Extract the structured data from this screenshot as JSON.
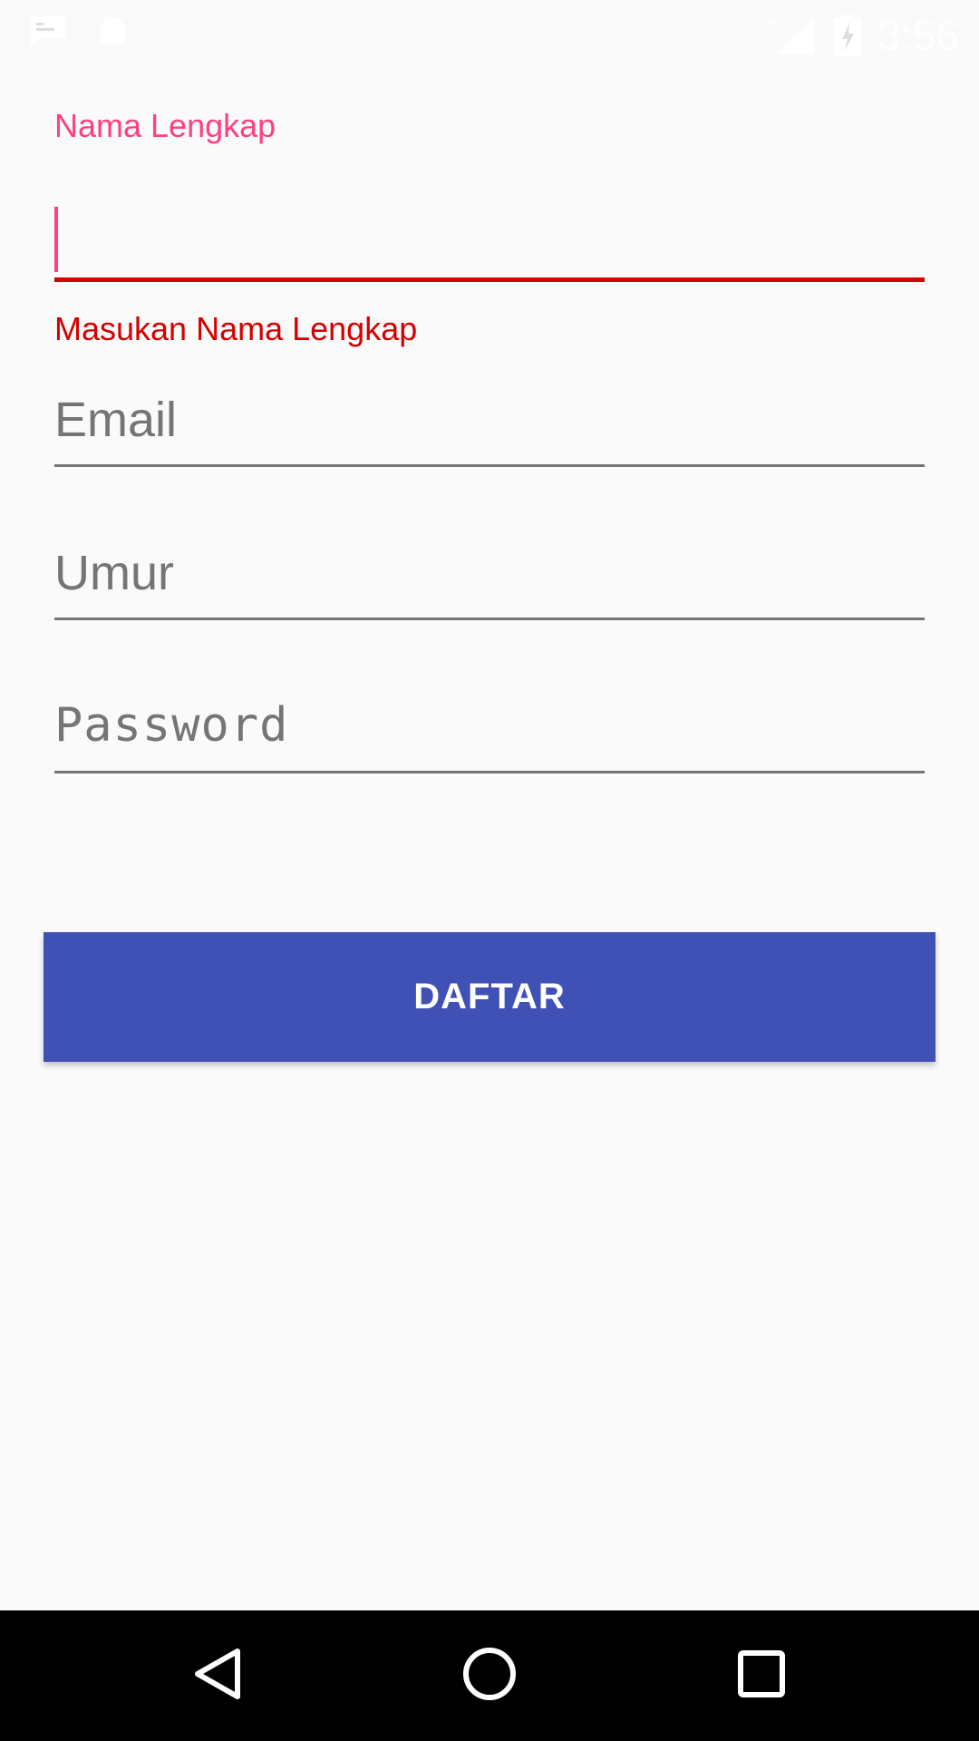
{
  "status_bar": {
    "time": "3:56",
    "network_type": "H",
    "icons": [
      "message-icon",
      "android-icon",
      "signal-icon",
      "battery-charging-icon"
    ]
  },
  "form": {
    "full_name": {
      "label": "Nama Lengkap",
      "value": "",
      "error": "Masukan Nama Lengkap"
    },
    "email": {
      "placeholder": "Email"
    },
    "age": {
      "placeholder": "Umur"
    },
    "password": {
      "placeholder": "Password"
    },
    "submit_label": "DAFTAR"
  },
  "colors": {
    "accent": "#ff4081",
    "error": "#d50000",
    "primary": "#3f51b5",
    "hint": "#757575",
    "background": "#fafafa"
  },
  "navigation": {
    "icons": [
      "back-icon",
      "home-icon",
      "recents-icon"
    ]
  }
}
